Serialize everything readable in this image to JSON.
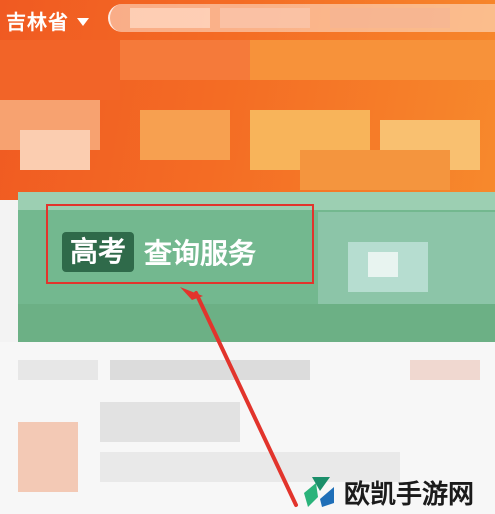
{
  "header": {
    "location_label": "吉林省",
    "location_dropdown_icon": "caret-down-icon"
  },
  "banner": {
    "tag_label": "高考",
    "title_label": "查询服务"
  },
  "annotation": {
    "highlight_color": "#e2342c",
    "arrow_icon": "arrow-icon"
  },
  "watermark": {
    "logo_icon": "ouka-logo-icon",
    "text": "欧凯手游网"
  },
  "colors": {
    "header_orange": "#f46c24",
    "banner_green": "#73b88f",
    "tag_dark_green": "#2f6a4a"
  }
}
